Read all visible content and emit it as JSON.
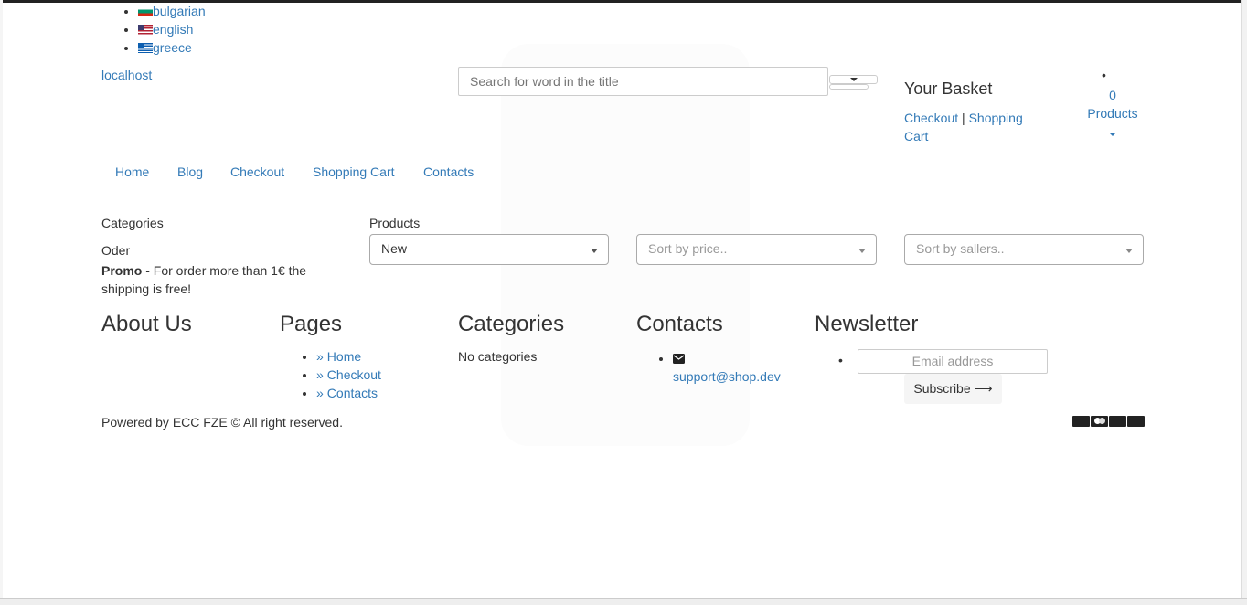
{
  "languages": [
    {
      "label": "bulgarian"
    },
    {
      "label": "english"
    },
    {
      "label": "greece"
    }
  ],
  "site_name": "localhost",
  "search": {
    "placeholder": "Search for word in the title"
  },
  "basket": {
    "title": "Your Basket",
    "checkout": "Checkout",
    "separator": "|",
    "cart_line1": "Shopping",
    "cart_line2": "Cart",
    "count": "0",
    "products_label": "Products"
  },
  "nav": [
    "Home",
    "Blog",
    "Checkout",
    "Shopping Cart",
    "Contacts"
  ],
  "sidebar": {
    "categories_label": "Categories",
    "oder_label": "Oder",
    "promo_bold": "Promo",
    "promo_line1": " - For order more than 1€ the",
    "promo_line2": "shipping is free!"
  },
  "filters": {
    "products_label": "Products",
    "products_selected": "New",
    "price_placeholder": "Sort by price..",
    "sellers_placeholder": "Sort by sallers.."
  },
  "footer": {
    "about_title": "About Us",
    "pages_title": "Pages",
    "pages_links": [
      "Home",
      "Checkout",
      "Contacts"
    ],
    "raquo": "»",
    "categories_title": "Categories",
    "categories_empty": "No categories",
    "contacts_title": "Contacts",
    "contact_email": "support@shop.dev",
    "newsletter_title": "Newsletter",
    "email_placeholder": "Email address",
    "subscribe_label": "Subscribe",
    "copyright": "Powered by ECC FZE © All right reserved.",
    "payment_icons": [
      "visa-icon",
      "mastercard-icon",
      "amex-icon",
      "paypal-icon"
    ]
  }
}
